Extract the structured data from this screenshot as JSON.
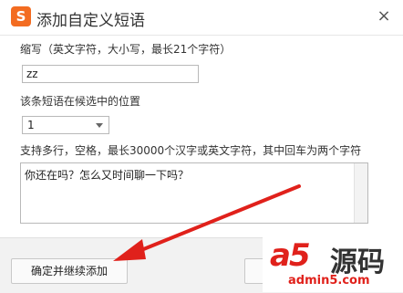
{
  "dialog": {
    "title": "添加自定义短语",
    "close": "×"
  },
  "abbr": {
    "label": "缩写（英文字符，大小写，最长21个字符）",
    "value": "zz"
  },
  "position": {
    "label": "该条短语在候选中的位置",
    "selected": "1"
  },
  "content": {
    "label": "支持多行，空格，最长30000个汉字或英文字符，其中回车为两个字符",
    "value": "你还在吗？怎么又时间聊一下吗？"
  },
  "footer": {
    "confirm_continue": "确定并继续添加"
  },
  "watermark": {
    "logo_text": "a5",
    "cn_text": "源码",
    "url": "admin5.com"
  },
  "colors": {
    "logo": "#f36c21",
    "arrow": "#e0211b"
  }
}
